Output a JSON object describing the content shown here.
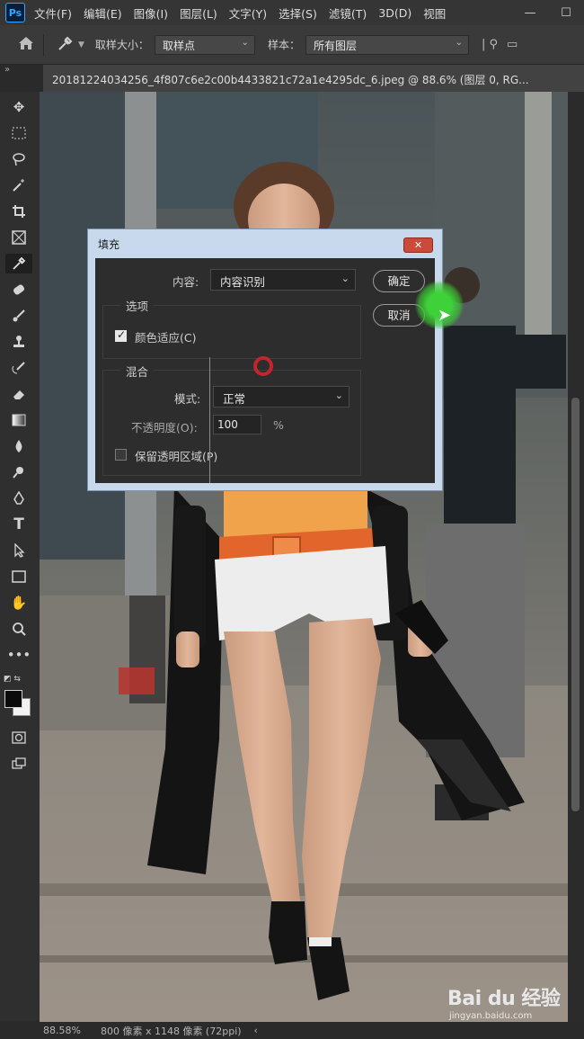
{
  "app": {
    "logo": "Ps",
    "menu": [
      "文件(F)",
      "编辑(E)",
      "图像(I)",
      "图层(L)",
      "文字(Y)",
      "选择(S)",
      "滤镜(T)",
      "3D(D)",
      "视图"
    ],
    "window_controls": [
      "—",
      "☐"
    ]
  },
  "options": {
    "sample_size_label": "取样大小：",
    "sample_size_value": "取样点",
    "sample_label": "样本：",
    "sample_value": "所有图层"
  },
  "document": {
    "tab_title": "20181224034256_4f807c6e2c00b4433821c72a1e4295dc_6.jpeg @ 88.6% (图层 0, RG..."
  },
  "status": {
    "zoom": "88.58%",
    "size": "800 像素 x 1148 像素 (72ppi)",
    "nav": "‹"
  },
  "dialog": {
    "title": "填充",
    "close": "✕",
    "content_label": "内容:",
    "content_value": "内容识别",
    "ok": "确定",
    "cancel": "取消",
    "options_group": "选项",
    "color_adapt": "颜色适应(C)",
    "color_adapt_checked": true,
    "blend_group": "混合",
    "mode_label": "模式:",
    "mode_value": "正常",
    "opacity_label": "不透明度(O):",
    "opacity_value": "100",
    "opacity_unit": "%",
    "preserve_transparency": "保留透明区域(P)",
    "preserve_transparency_checked": false
  },
  "watermark": {
    "main": "Bai du 经验",
    "sub": "jingyan.baidu.com"
  }
}
